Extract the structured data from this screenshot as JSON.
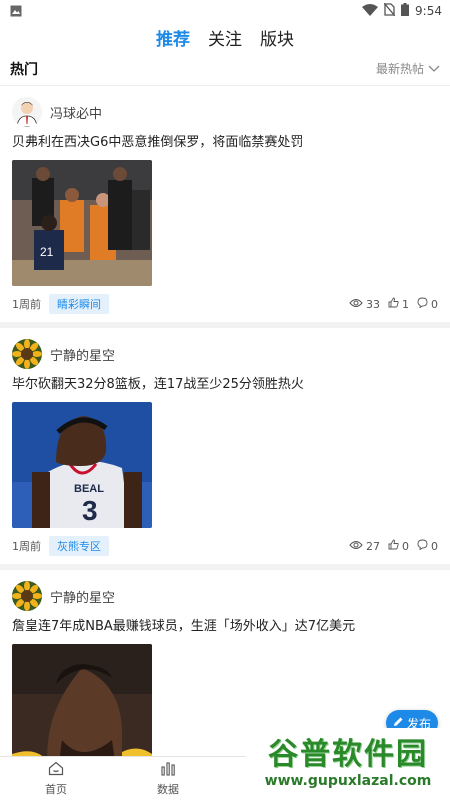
{
  "status_bar": {
    "time": "9:54"
  },
  "top_tabs": [
    {
      "label": "推荐",
      "active": true
    },
    {
      "label": "关注",
      "active": false
    },
    {
      "label": "版块",
      "active": false
    }
  ],
  "section": {
    "title": "热门",
    "sort_label": "最新热帖"
  },
  "posts": [
    {
      "author": "冯球必中",
      "title": "贝弗利在西决G6中恶意推倒保罗，将面临禁赛处罚",
      "time": "1周前",
      "tag": "睛彩瞬间",
      "views": "33",
      "likes": "1",
      "comments": "0"
    },
    {
      "author": "宁静的星空",
      "title": "毕尔砍翻天32分8篮板，连17战至少25分领胜热火",
      "time": "1周前",
      "tag": "灰熊专区",
      "views": "27",
      "likes": "0",
      "comments": "0"
    },
    {
      "author": "宁静的星空",
      "title": "詹皇连7年成NBA最赚钱球员，生涯「场外收入」达7亿美元"
    }
  ],
  "fab": {
    "label": "发布"
  },
  "bottom_nav": [
    {
      "label": "首页"
    },
    {
      "label": "数据"
    }
  ],
  "watermark": {
    "title": "谷普软件园",
    "url": "www.gupuxlazal.com"
  },
  "colors": {
    "accent": "#1e8ae8",
    "tag_bg": "#e4f1fd",
    "watermark_green": "#2a8a2a"
  }
}
